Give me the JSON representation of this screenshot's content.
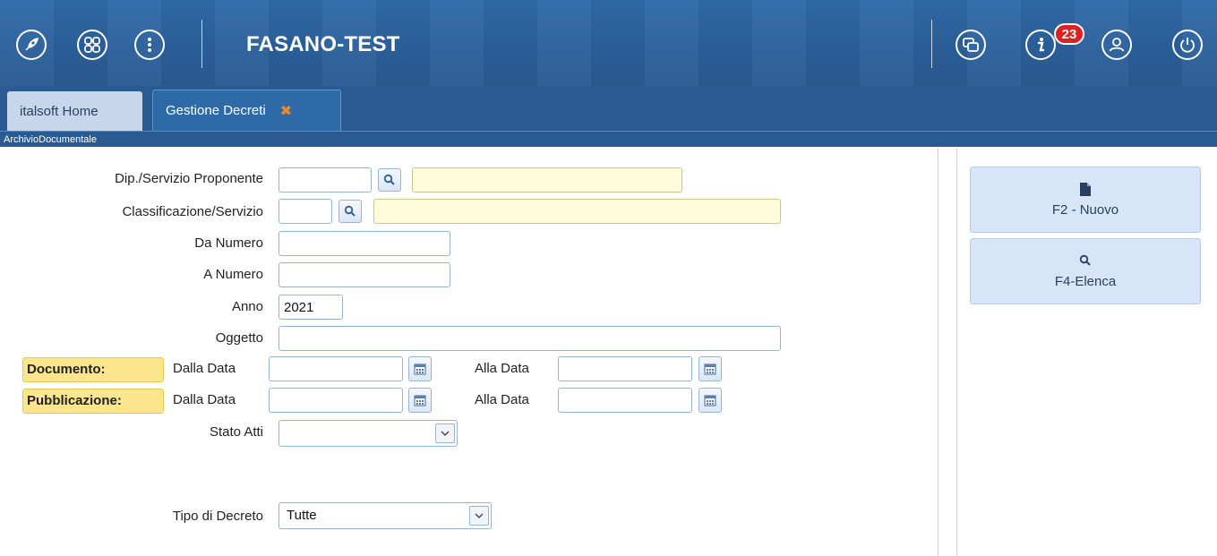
{
  "header": {
    "title": "FASANO-TEST",
    "notification_count": "23",
    "icons": [
      "rocket-icon",
      "apps-grid-icon",
      "more-vertical-icon",
      "windows-icon",
      "info-icon",
      "user-icon",
      "power-icon"
    ]
  },
  "tabs": [
    {
      "label": "italsoft Home"
    },
    {
      "label": "Gestione Decreti",
      "close": "✖"
    }
  ],
  "breadcrumb": "ArchivioDocumentale",
  "form": {
    "dip_label": "Dip./Servizio Proponente",
    "class_label": "Classificazione/Servizio",
    "da_numero_label": "Da Numero",
    "a_numero_label": "A Numero",
    "anno_label": "Anno",
    "anno_value": "2021",
    "oggetto_label": "Oggetto",
    "documento_tag": "Documento:",
    "pubblicazione_tag": "Pubblicazione:",
    "dalla_data_label": "Dalla Data",
    "alla_data_label": "Alla Data",
    "stato_atti_label": "Stato Atti",
    "stato_atti_value": "",
    "tipo_decreto_label": "Tipo di Decreto",
    "tipo_decreto_value": "Tutte"
  },
  "actions": {
    "nuovo": "F2 - Nuovo",
    "elenca": "F4-Elenca"
  },
  "colors": {
    "header_bg": "#2f6aa8",
    "badge": "#e02020",
    "close_x": "#f08a28",
    "tag_bg": "#fbe58d",
    "lookup_bg": "#fdfbd9",
    "action_bg": "#d6e5f8"
  }
}
